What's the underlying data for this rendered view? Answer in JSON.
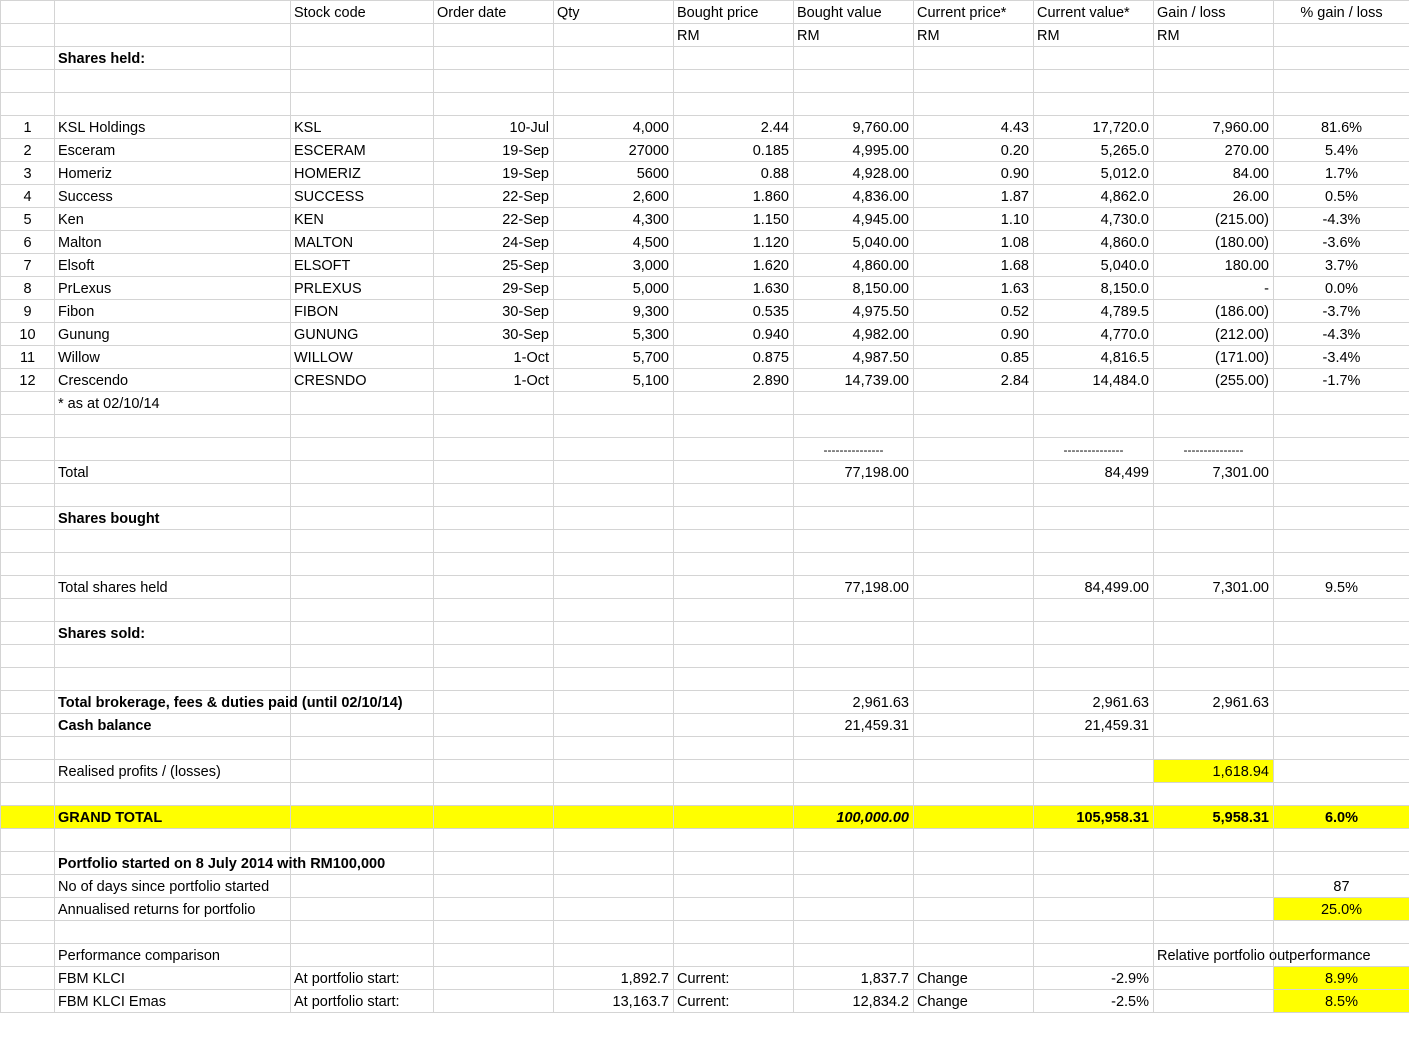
{
  "headers": {
    "stock_code": "Stock code",
    "order_date": "Order date",
    "qty": "Qty",
    "bought_price": "Bought price",
    "bought_value": "Bought value",
    "current_price": "Current price*",
    "current_value": "Current value*",
    "gain_loss": "Gain / loss",
    "pct_gain_loss": "% gain / loss",
    "unit": "RM"
  },
  "sections": {
    "shares_held": "Shares held:",
    "shares_bought": "Shares bought",
    "shares_sold": "Shares sold:"
  },
  "holdings": [
    {
      "no": "1",
      "name": "KSL Holdings",
      "code": "KSL",
      "date": "10-Jul",
      "qty": "4,000",
      "bought_price": "2.44",
      "bought_value": "9,760.00",
      "current_price": "4.43",
      "current_value": "17,720.0",
      "gain": "7,960.00",
      "pct": "81.6%"
    },
    {
      "no": "2",
      "name": "Esceram",
      "code": "ESCERAM",
      "date": "19-Sep",
      "qty": "27000",
      "bought_price": "0.185",
      "bought_value": "4,995.00",
      "current_price": "0.20",
      "current_value": "5,265.0",
      "gain": "270.00",
      "pct": "5.4%"
    },
    {
      "no": "3",
      "name": "Homeriz",
      "code": "HOMERIZ",
      "date": "19-Sep",
      "qty": "5600",
      "bought_price": "0.88",
      "bought_value": "4,928.00",
      "current_price": "0.90",
      "current_value": "5,012.0",
      "gain": "84.00",
      "pct": "1.7%"
    },
    {
      "no": "4",
      "name": "Success",
      "code": "SUCCESS",
      "date": "22-Sep",
      "qty": "2,600",
      "bought_price": "1.860",
      "bought_value": "4,836.00",
      "current_price": "1.87",
      "current_value": "4,862.0",
      "gain": "26.00",
      "pct": "0.5%"
    },
    {
      "no": "5",
      "name": "Ken",
      "code": "KEN",
      "date": "22-Sep",
      "qty": "4,300",
      "bought_price": "1.150",
      "bought_value": "4,945.00",
      "current_price": "1.10",
      "current_value": "4,730.0",
      "gain": "(215.00)",
      "pct": "-4.3%"
    },
    {
      "no": "6",
      "name": "Malton",
      "code": "MALTON",
      "date": "24-Sep",
      "qty": "4,500",
      "bought_price": "1.120",
      "bought_value": "5,040.00",
      "current_price": "1.08",
      "current_value": "4,860.0",
      "gain": "(180.00)",
      "pct": "-3.6%"
    },
    {
      "no": "7",
      "name": "Elsoft",
      "code": "ELSOFT",
      "date": "25-Sep",
      "qty": "3,000",
      "bought_price": "1.620",
      "bought_value": "4,860.00",
      "current_price": "1.68",
      "current_value": "5,040.0",
      "gain": "180.00",
      "pct": "3.7%"
    },
    {
      "no": "8",
      "name": "PrLexus",
      "code": "PRLEXUS",
      "date": "29-Sep",
      "qty": "5,000",
      "bought_price": "1.630",
      "bought_value": "8,150.00",
      "current_price": "1.63",
      "current_value": "8,150.0",
      "gain": "-",
      "pct": "0.0%"
    },
    {
      "no": "9",
      "name": "Fibon",
      "code": "FIBON",
      "date": "30-Sep",
      "qty": "9,300",
      "bought_price": "0.535",
      "bought_value": "4,975.50",
      "current_price": "0.52",
      "current_value": "4,789.5",
      "gain": "(186.00)",
      "pct": "-3.7%"
    },
    {
      "no": "10",
      "name": "Gunung",
      "code": "GUNUNG",
      "date": "30-Sep",
      "qty": "5,300",
      "bought_price": "0.940",
      "bought_value": "4,982.00",
      "current_price": "0.90",
      "current_value": "4,770.0",
      "gain": "(212.00)",
      "pct": "-4.3%"
    },
    {
      "no": "11",
      "name": "Willow",
      "code": "WILLOW",
      "date": "1-Oct",
      "qty": "5,700",
      "bought_price": "0.875",
      "bought_value": "4,987.50",
      "current_price": "0.85",
      "current_value": "4,816.5",
      "gain": "(171.00)",
      "pct": "-3.4%"
    },
    {
      "no": "12",
      "name": "Crescendo",
      "code": "CRESNDO",
      "date": "1-Oct",
      "qty": "5,100",
      "bought_price": "2.890",
      "bought_value": "14,739.00",
      "current_price": "2.84",
      "current_value": "14,484.0",
      "gain": "(255.00)",
      "pct": "-1.7%"
    }
  ],
  "note_as_at": "* as at 02/10/14",
  "dashes": "---------------",
  "total": {
    "label": "Total",
    "bought_value": "77,198.00",
    "current_value": "84,499",
    "gain": "7,301.00"
  },
  "total_shares_held": {
    "label": "Total shares held",
    "bought_value": "77,198.00",
    "current_value": "84,499.00",
    "gain": "7,301.00",
    "pct": "9.5%"
  },
  "brokerage": {
    "label": "Total brokerage, fees & duties paid (until 02/10/14)",
    "bought_value": "2,961.63",
    "current_value": "2,961.63",
    "gain": "2,961.63"
  },
  "cash_balance": {
    "label": "Cash balance",
    "bought_value": "21,459.31",
    "current_value": "21,459.31"
  },
  "realised": {
    "label": "Realised profits / (losses)",
    "gain": "1,618.94"
  },
  "grand_total": {
    "label": "GRAND TOTAL",
    "bought_value": "100,000.00",
    "current_value": "105,958.31",
    "gain": "5,958.31",
    "pct": "6.0%"
  },
  "portfolio": {
    "started": "Portfolio started on 8 July 2014 with RM100,000",
    "days_label": "No of days since portfolio started",
    "days": "87",
    "annualised_label": "Annualised returns for portfolio",
    "annualised": "25.0%"
  },
  "performance": {
    "label": "Performance comparison",
    "relative_label": "Relative portfolio outperformance",
    "rows": [
      {
        "index": "FBM KLCI",
        "start_label": "At portfolio start:",
        "start": "1,892.7",
        "current_label": "Current:",
        "current": "1,837.7",
        "change_label": "Change",
        "change": "-2.9%",
        "relative": "8.9%"
      },
      {
        "index": "FBM KLCI Emas",
        "start_label": "At portfolio start:",
        "start": "13,163.7",
        "current_label": "Current:",
        "current": "12,834.2",
        "change_label": "Change",
        "change": "-2.5%",
        "relative": "8.5%"
      }
    ]
  },
  "colors": {
    "highlight": "#ffff00",
    "gridline": "#d4d4d4"
  }
}
